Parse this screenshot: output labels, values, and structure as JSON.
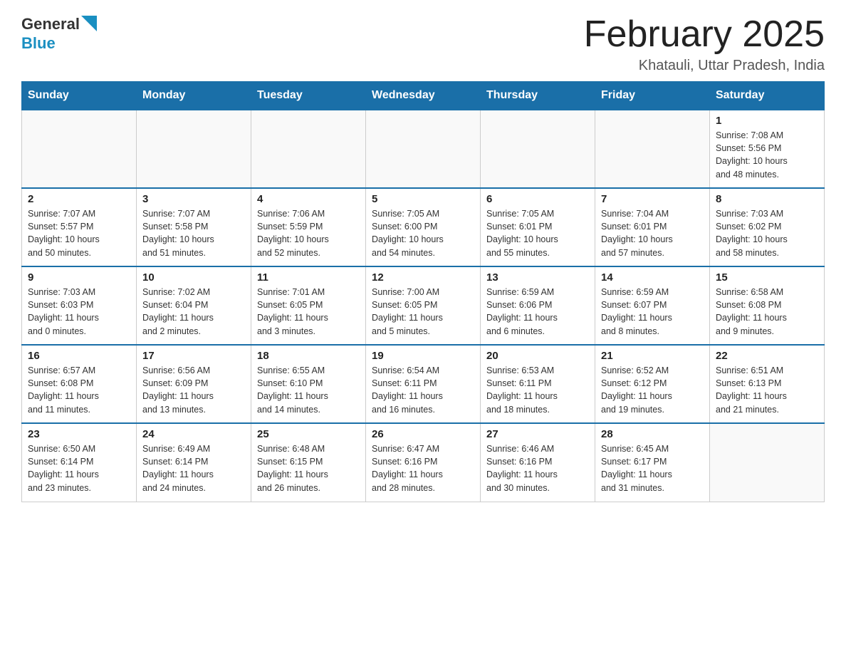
{
  "header": {
    "logo_text_general": "General",
    "logo_text_blue": "Blue",
    "title": "February 2025",
    "location": "Khatauli, Uttar Pradesh, India"
  },
  "weekdays": [
    "Sunday",
    "Monday",
    "Tuesday",
    "Wednesday",
    "Thursday",
    "Friday",
    "Saturday"
  ],
  "weeks": [
    [
      {
        "day": "",
        "info": ""
      },
      {
        "day": "",
        "info": ""
      },
      {
        "day": "",
        "info": ""
      },
      {
        "day": "",
        "info": ""
      },
      {
        "day": "",
        "info": ""
      },
      {
        "day": "",
        "info": ""
      },
      {
        "day": "1",
        "info": "Sunrise: 7:08 AM\nSunset: 5:56 PM\nDaylight: 10 hours\nand 48 minutes."
      }
    ],
    [
      {
        "day": "2",
        "info": "Sunrise: 7:07 AM\nSunset: 5:57 PM\nDaylight: 10 hours\nand 50 minutes."
      },
      {
        "day": "3",
        "info": "Sunrise: 7:07 AM\nSunset: 5:58 PM\nDaylight: 10 hours\nand 51 minutes."
      },
      {
        "day": "4",
        "info": "Sunrise: 7:06 AM\nSunset: 5:59 PM\nDaylight: 10 hours\nand 52 minutes."
      },
      {
        "day": "5",
        "info": "Sunrise: 7:05 AM\nSunset: 6:00 PM\nDaylight: 10 hours\nand 54 minutes."
      },
      {
        "day": "6",
        "info": "Sunrise: 7:05 AM\nSunset: 6:01 PM\nDaylight: 10 hours\nand 55 minutes."
      },
      {
        "day": "7",
        "info": "Sunrise: 7:04 AM\nSunset: 6:01 PM\nDaylight: 10 hours\nand 57 minutes."
      },
      {
        "day": "8",
        "info": "Sunrise: 7:03 AM\nSunset: 6:02 PM\nDaylight: 10 hours\nand 58 minutes."
      }
    ],
    [
      {
        "day": "9",
        "info": "Sunrise: 7:03 AM\nSunset: 6:03 PM\nDaylight: 11 hours\nand 0 minutes."
      },
      {
        "day": "10",
        "info": "Sunrise: 7:02 AM\nSunset: 6:04 PM\nDaylight: 11 hours\nand 2 minutes."
      },
      {
        "day": "11",
        "info": "Sunrise: 7:01 AM\nSunset: 6:05 PM\nDaylight: 11 hours\nand 3 minutes."
      },
      {
        "day": "12",
        "info": "Sunrise: 7:00 AM\nSunset: 6:05 PM\nDaylight: 11 hours\nand 5 minutes."
      },
      {
        "day": "13",
        "info": "Sunrise: 6:59 AM\nSunset: 6:06 PM\nDaylight: 11 hours\nand 6 minutes."
      },
      {
        "day": "14",
        "info": "Sunrise: 6:59 AM\nSunset: 6:07 PM\nDaylight: 11 hours\nand 8 minutes."
      },
      {
        "day": "15",
        "info": "Sunrise: 6:58 AM\nSunset: 6:08 PM\nDaylight: 11 hours\nand 9 minutes."
      }
    ],
    [
      {
        "day": "16",
        "info": "Sunrise: 6:57 AM\nSunset: 6:08 PM\nDaylight: 11 hours\nand 11 minutes."
      },
      {
        "day": "17",
        "info": "Sunrise: 6:56 AM\nSunset: 6:09 PM\nDaylight: 11 hours\nand 13 minutes."
      },
      {
        "day": "18",
        "info": "Sunrise: 6:55 AM\nSunset: 6:10 PM\nDaylight: 11 hours\nand 14 minutes."
      },
      {
        "day": "19",
        "info": "Sunrise: 6:54 AM\nSunset: 6:11 PM\nDaylight: 11 hours\nand 16 minutes."
      },
      {
        "day": "20",
        "info": "Sunrise: 6:53 AM\nSunset: 6:11 PM\nDaylight: 11 hours\nand 18 minutes."
      },
      {
        "day": "21",
        "info": "Sunrise: 6:52 AM\nSunset: 6:12 PM\nDaylight: 11 hours\nand 19 minutes."
      },
      {
        "day": "22",
        "info": "Sunrise: 6:51 AM\nSunset: 6:13 PM\nDaylight: 11 hours\nand 21 minutes."
      }
    ],
    [
      {
        "day": "23",
        "info": "Sunrise: 6:50 AM\nSunset: 6:14 PM\nDaylight: 11 hours\nand 23 minutes."
      },
      {
        "day": "24",
        "info": "Sunrise: 6:49 AM\nSunset: 6:14 PM\nDaylight: 11 hours\nand 24 minutes."
      },
      {
        "day": "25",
        "info": "Sunrise: 6:48 AM\nSunset: 6:15 PM\nDaylight: 11 hours\nand 26 minutes."
      },
      {
        "day": "26",
        "info": "Sunrise: 6:47 AM\nSunset: 6:16 PM\nDaylight: 11 hours\nand 28 minutes."
      },
      {
        "day": "27",
        "info": "Sunrise: 6:46 AM\nSunset: 6:16 PM\nDaylight: 11 hours\nand 30 minutes."
      },
      {
        "day": "28",
        "info": "Sunrise: 6:45 AM\nSunset: 6:17 PM\nDaylight: 11 hours\nand 31 minutes."
      },
      {
        "day": "",
        "info": ""
      }
    ]
  ]
}
